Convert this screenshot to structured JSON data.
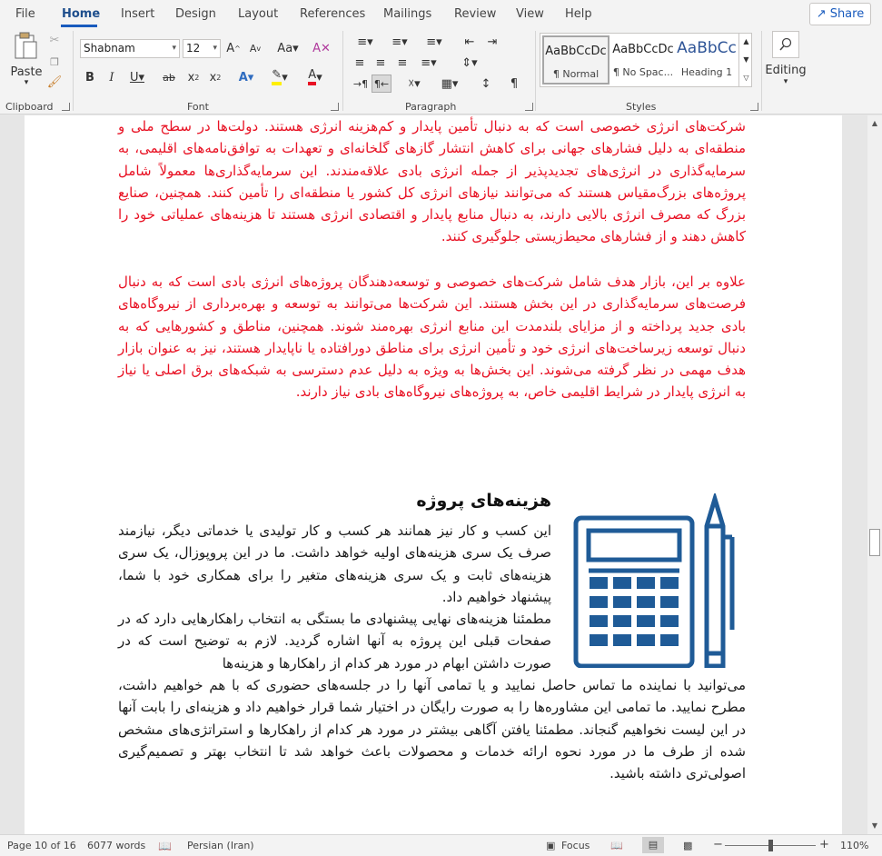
{
  "menu": {
    "tabs": [
      "File",
      "Home",
      "Insert",
      "Design",
      "Layout",
      "References",
      "Mailings",
      "Review",
      "View",
      "Help"
    ],
    "active_tab": "Home",
    "share_label": "Share"
  },
  "ribbon": {
    "clipboard": {
      "label": "Clipboard",
      "paste_label": "Paste"
    },
    "font": {
      "label": "Font",
      "font_name": "Shabnam",
      "font_size": "12"
    },
    "paragraph": {
      "label": "Paragraph"
    },
    "styles": {
      "label": "Styles",
      "items": [
        {
          "preview": "AaBbCcDc",
          "name": "¶ Normal"
        },
        {
          "preview": "AaBbCcDc",
          "name": "¶ No Spac..."
        },
        {
          "preview": "AaBbCc",
          "name": "Heading 1"
        }
      ]
    },
    "editing": {
      "label": "Editing"
    }
  },
  "document": {
    "paragraph_1": "شرکت‌های انرژی خصوصی است که به دنبال تأمین پایدار و کم‌هزینه انرژی هستند. دولت‌ها در سطح ملی و منطقه‌ای به دلیل فشارهای جهانی برای کاهش انتشار گازهای گلخانه‌ای و تعهدات به توافق‌نامه‌های اقلیمی، به سرمایه‌گذاری در انرژی‌های تجدیدپذیر از جمله انرژی بادی علاقه‌مندند. این سرمایه‌گذاری‌ها معمولاً شامل پروژه‌های بزرگ‌مقیاس هستند که می‌توانند نیازهای انرژی کل کشور یا منطقه‌ای را تأمین کنند. همچنین، صنایع بزرگ که مصرف انرژی بالایی دارند، به دنبال منابع پایدار و اقتصادی انرژی هستند تا هزینه‌های عملیاتی خود را کاهش دهند و از فشارهای محیط‌زیستی جلوگیری کنند.",
    "paragraph_2": "علاوه بر این، بازار هدف شامل شرکت‌های خصوصی و توسعه‌دهندگان پروژه‌های انرژی بادی است که به دنبال فرصت‌های سرمایه‌گذاری در این بخش هستند. این شرکت‌ها می‌توانند به توسعه و بهره‌برداری از نیروگاه‌های بادی جدید پرداخته و از مزایای بلندمدت این منابع انرژی بهره‌مند شوند. همچنین، مناطق و کشورهایی که به دنبال توسعه زیرساخت‌های انرژی خود و تأمین انرژی برای مناطق دورافتاده یا ناپایدار هستند، نیز به عنوان بازار هدف مهمی در نظر گرفته می‌شوند. این بخش‌ها به ویژه به دلیل عدم دسترسی به شبکه‌های برق اصلی یا نیاز به انرژی پایدار در شرایط اقلیمی خاص، به پروژه‌های نیروگاه‌های بادی نیاز دارند.",
    "heading": "هزینه‌های پروژه",
    "paragraph_3a": "این کسب و کار نیز همانند هر کسب و کار تولیدی یا خدماتی دیگر، نیازمند صرف یک سری هزینه‌های اولیه خواهد داشت. ما در این پروپوزال، یک سری هزینه‌های ثابت و یک سری هزینه‌های متغیر را برای همکاری خود با شما، پیشنهاد خواهیم داد.",
    "paragraph_4a": "مطمئنا هزینه‌های نهایی پیشنهادی ما بستگی به انتخاب راهکارهایی دارد که در صفحات قبلی این پروژه به آنها اشاره گردید. لازم به توضیح است که در صورت داشتن ابهام در مورد هر کدام از راهکارها و هزینه‌ها",
    "paragraph_4b": "می‌توانید با نماینده ما تماس حاصل نمایید و یا تمامی آنها را در جلسه‌های حضوری که با هم خواهیم داشت، مطرح نمایید. ما تمامی این مشاوره‌ها را به صورت رایگان در اختیار شما قرار خواهیم داد و هزینه‌ای را بابت آنها در این لیست نخواهیم گنجاند. مطمئنا یافتن آگاهی بیشتر در مورد هر کدام از راهکارها و استراتژی‌های مشخص شده از طرف ما در مورد نحوه ارائه خدمات و محصولات باعث خواهد شد تا انتخاب بهتر و تصمیم‌گیری اصولی‌تری داشته باشید."
  },
  "status_bar": {
    "page": "Page 10 of 16",
    "words": "6077 words",
    "language": "Persian (Iran)",
    "focus": "Focus",
    "zoom": "110%"
  },
  "colors": {
    "accent": "#185abd",
    "red_text": "#e81123",
    "icon_blue": "#1f5b97"
  }
}
